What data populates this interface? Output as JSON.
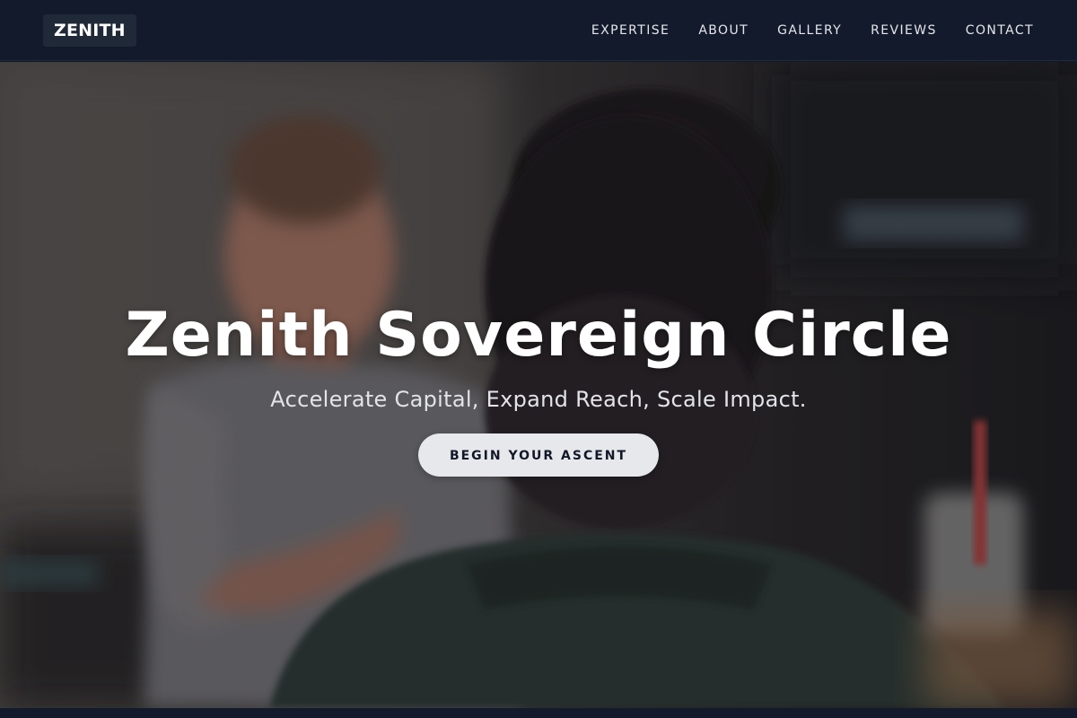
{
  "brand": {
    "logo_text": "ZENITH"
  },
  "nav": {
    "items": [
      {
        "label": "EXPERTISE"
      },
      {
        "label": "ABOUT"
      },
      {
        "label": "GALLERY"
      },
      {
        "label": "REVIEWS"
      },
      {
        "label": "CONTACT"
      }
    ]
  },
  "hero": {
    "title": "Zenith Sovereign Circle",
    "subtitle": "Accelerate Capital, Expand Reach, Scale Impact.",
    "cta_label": "BEGIN YOUR ASCENT",
    "background_image": "photo-of-two-people-talking-in-cafe"
  },
  "colors": {
    "navbar_bg": "#121a2b",
    "logo_bg": "#1f2937",
    "cta_bg": "#e7e8ec",
    "cta_text": "#111827",
    "hero_text": "#ffffff"
  }
}
